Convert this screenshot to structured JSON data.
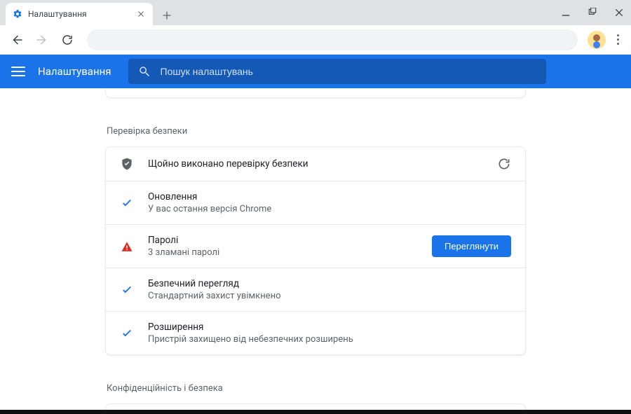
{
  "browser": {
    "tab_title": "Налаштування"
  },
  "appbar": {
    "title": "Налаштування",
    "search_placeholder": "Пошук налаштувань"
  },
  "sections": {
    "safety": {
      "label": "Перевірка безпеки",
      "header": {
        "title": "Щойно виконано перевірку безпеки"
      },
      "rows": {
        "updates": {
          "title": "Оновлення",
          "sub": "У вас остання версія Chrome"
        },
        "passwords": {
          "title": "Паролі",
          "sub": "3 зламані паролі",
          "action": "Переглянути"
        },
        "safebrowsing": {
          "title": "Безпечний перегляд",
          "sub": "Стандартний захист увімкнено"
        },
        "extensions": {
          "title": "Розширення",
          "sub": "Пристрій захищено від небезпечних розширень"
        }
      }
    },
    "privacy": {
      "label": "Конфіденційність і безпека"
    }
  }
}
